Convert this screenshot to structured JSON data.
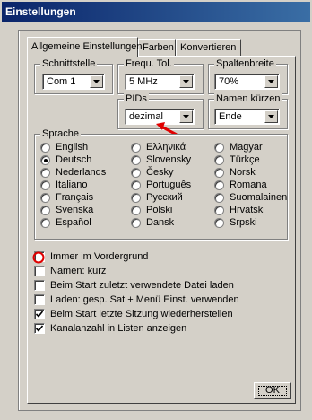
{
  "window": {
    "title": "Einstellungen"
  },
  "tabs": [
    {
      "label": "Allgemeine Einstellungen"
    },
    {
      "label": "Farben"
    },
    {
      "label": "Konvertieren"
    }
  ],
  "groups": {
    "schnittstelle": {
      "label": "Schnittstelle",
      "value": "Com 1"
    },
    "frequ_tol": {
      "label": "Frequ. Tol.",
      "value": "5 MHz"
    },
    "spaltenbreite": {
      "label": "Spaltenbreite",
      "value": "70%"
    },
    "pids": {
      "label": "PIDs",
      "value": "dezimal"
    },
    "namen_kuerzen": {
      "label": "Namen kürzen",
      "value": "Ende"
    },
    "sprache": {
      "label": "Sprache",
      "selected": "Deutsch",
      "options": [
        "English",
        "Deutsch",
        "Nederlands",
        "Italiano",
        "Français",
        "Svenska",
        "Español",
        "Ελληνικά",
        "Slovensky",
        "Česky",
        "Português",
        "Русский",
        "Polski",
        "Dansk",
        "Magyar",
        "Türkçe",
        "Norsk",
        "Romana",
        "Suomalainen",
        "Hrvatski",
        "Srpski"
      ]
    }
  },
  "checkboxes": [
    {
      "label": "Immer im Vordergrund",
      "checked": false
    },
    {
      "label": "Namen: kurz",
      "checked": false
    },
    {
      "label": "Beim Start zuletzt verwendete Datei laden",
      "checked": false
    },
    {
      "label": "Laden: gesp. Sat + Menü Einst. verwenden",
      "checked": false
    },
    {
      "label": "Beim Start letzte Sitzung wiederherstellen",
      "checked": true
    },
    {
      "label": "Kanalanzahl in Listen anzeigen",
      "checked": true
    }
  ],
  "buttons": {
    "ok": "OK"
  },
  "annotations": {
    "arrow_color": "#e00000",
    "circle_color": "#e00000"
  }
}
